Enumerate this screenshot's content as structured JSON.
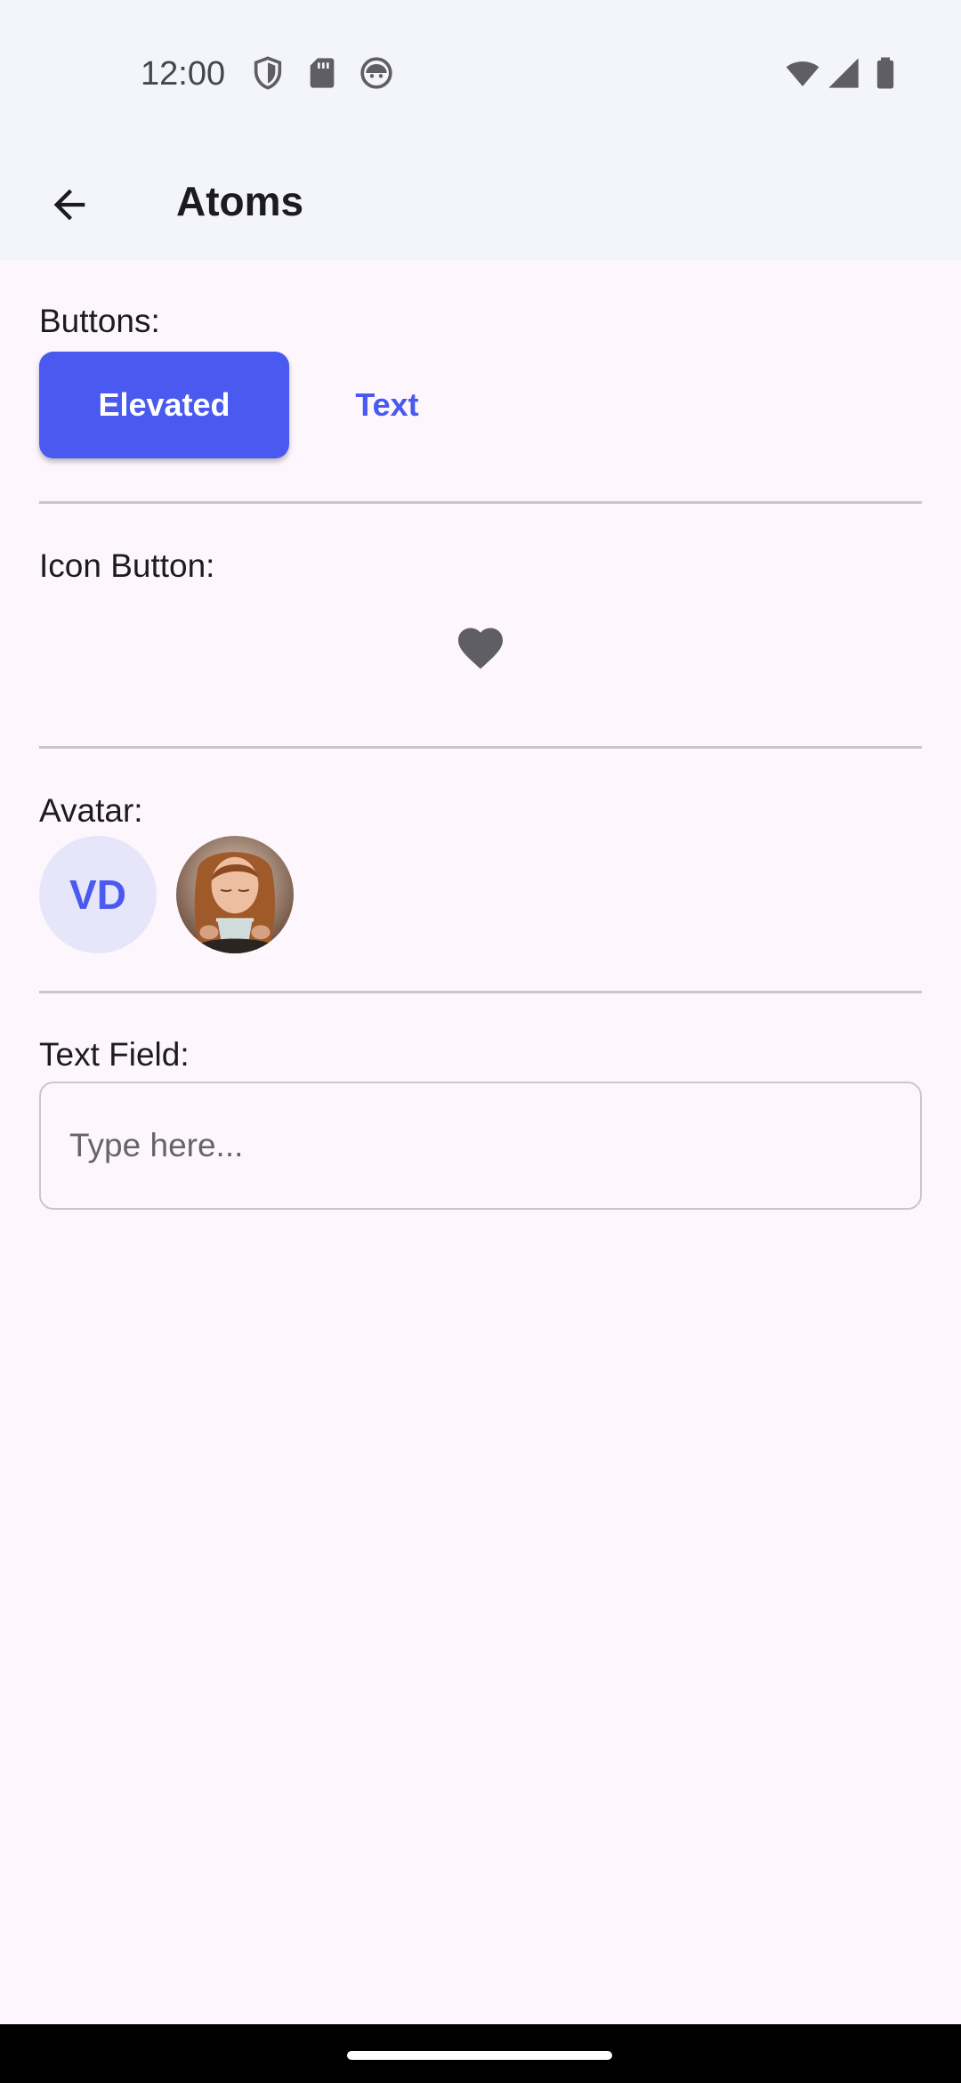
{
  "status_bar": {
    "time": "12:00",
    "icons": [
      "shield-icon",
      "sd-card-icon",
      "android-face-icon",
      "wifi-icon",
      "signal-icon",
      "battery-icon"
    ]
  },
  "app_bar": {
    "title": "Atoms",
    "back_icon": "arrow-back-icon"
  },
  "sections": {
    "buttons": {
      "label": "Buttons:",
      "elevated_label": "Elevated",
      "text_label": "Text"
    },
    "icon_button": {
      "label": "Icon Button:",
      "icon": "heart-icon"
    },
    "avatar": {
      "label": "Avatar:",
      "initials": "VD",
      "photo_icon": "avatar-photo-woman-drinking-coffee"
    },
    "text_field": {
      "label": "Text Field:",
      "value": "",
      "placeholder": "Type here..."
    }
  },
  "colors": {
    "primary": "#4a5af0",
    "background": "#fdf7fd",
    "app_bar": "#f4f4fb",
    "avatar_bg": "#e7e5fa",
    "icon_grey": "#5f5e64"
  }
}
